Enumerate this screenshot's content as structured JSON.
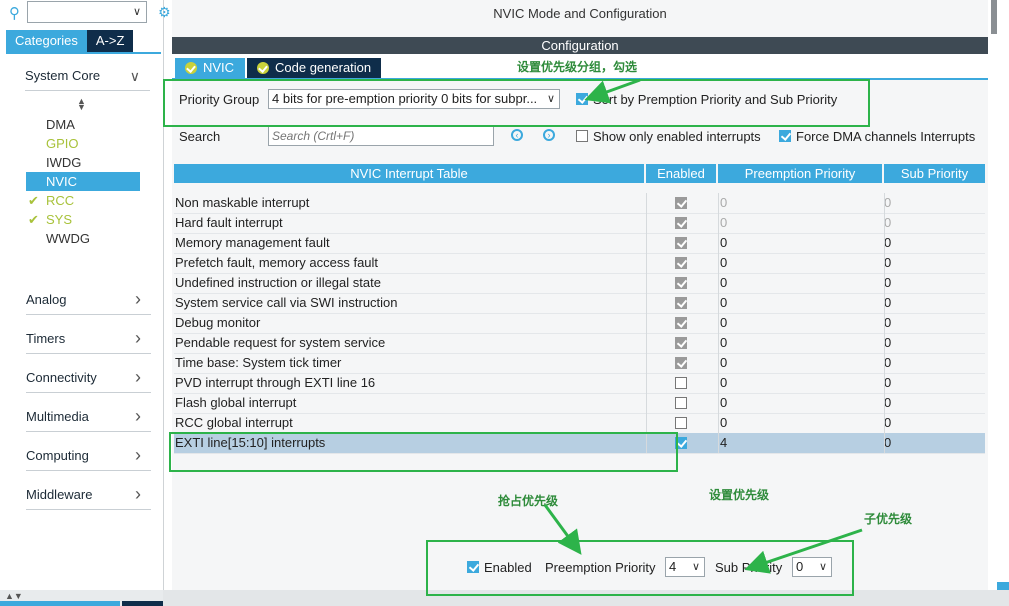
{
  "sidebar": {
    "tabs": [
      "Categories",
      "A->Z"
    ],
    "groups_top": "System Core",
    "system_core_items": [
      {
        "label": "DMA",
        "state": "normal"
      },
      {
        "label": "GPIO",
        "state": "lime"
      },
      {
        "label": "IWDG",
        "state": "normal"
      },
      {
        "label": "NVIC",
        "state": "selected"
      },
      {
        "label": "RCC",
        "state": "checked"
      },
      {
        "label": "SYS",
        "state": "checked"
      },
      {
        "label": "WWDG",
        "state": "normal"
      }
    ],
    "groups": [
      "Analog",
      "Timers",
      "Connectivity",
      "Multimedia",
      "Computing",
      "Middleware"
    ]
  },
  "header": {
    "title": "NVIC Mode and Configuration",
    "config_label": "Configuration",
    "tabs": [
      "NVIC",
      "Code generation"
    ]
  },
  "controls": {
    "priority_group_label": "Priority Group",
    "priority_group_value": "4 bits for pre-emption priority 0 bits for subpr...",
    "sort_label": "Sort by Premption Priority and Sub Priority",
    "search_label": "Search",
    "search_placeholder": "Search (Crtl+F)",
    "show_enabled_label": "Show only enabled interrupts",
    "force_dma_label": "Force DMA channels Interrupts"
  },
  "table": {
    "headers": [
      "NVIC Interrupt Table",
      "Enabled",
      "Preemption Priority",
      "Sub Priority"
    ],
    "rows": [
      {
        "name": "Non maskable interrupt",
        "enabled": "gray",
        "pp": "0",
        "sp": "0",
        "dim": true
      },
      {
        "name": "Hard fault interrupt",
        "enabled": "gray",
        "pp": "0",
        "sp": "0",
        "dim": true
      },
      {
        "name": "Memory management fault",
        "enabled": "gray",
        "pp": "0",
        "sp": "0",
        "dim": false
      },
      {
        "name": "Prefetch fault, memory access fault",
        "enabled": "gray",
        "pp": "0",
        "sp": "0",
        "dim": false
      },
      {
        "name": "Undefined instruction or illegal state",
        "enabled": "gray",
        "pp": "0",
        "sp": "0",
        "dim": false
      },
      {
        "name": "System service call via SWI instruction",
        "enabled": "gray",
        "pp": "0",
        "sp": "0",
        "dim": false
      },
      {
        "name": "Debug monitor",
        "enabled": "gray",
        "pp": "0",
        "sp": "0",
        "dim": false
      },
      {
        "name": "Pendable request for system service",
        "enabled": "gray",
        "pp": "0",
        "sp": "0",
        "dim": false
      },
      {
        "name": "Time base: System tick timer",
        "enabled": "gray",
        "pp": "0",
        "sp": "0",
        "dim": false
      },
      {
        "name": "PVD interrupt through EXTI line 16",
        "enabled": "off",
        "pp": "0",
        "sp": "0",
        "dim": false
      },
      {
        "name": "Flash global interrupt",
        "enabled": "off",
        "pp": "0",
        "sp": "0",
        "dim": false
      },
      {
        "name": "RCC global interrupt",
        "enabled": "off",
        "pp": "0",
        "sp": "0",
        "dim": false
      },
      {
        "name": "EXTI line[15:10] interrupts",
        "enabled": "on",
        "pp": "4",
        "sp": "0",
        "dim": false,
        "selected": true
      }
    ]
  },
  "bottom": {
    "enabled_label": "Enabled",
    "preemption_label": "Preemption Priority",
    "preemption_value": "4",
    "sub_label": "Sub Priority",
    "sub_value": "0"
  },
  "annotations": {
    "group_note": "设置优先级分组，勾选",
    "preempt_note": "抢占优先级",
    "set_note": "设置优先级",
    "sub_note": "子优先级"
  },
  "colors": {
    "accent": "#3ca9dd",
    "annotation_green": "#2db34a",
    "dark_bar": "#3e4a54",
    "lime": "#a8c23a"
  }
}
